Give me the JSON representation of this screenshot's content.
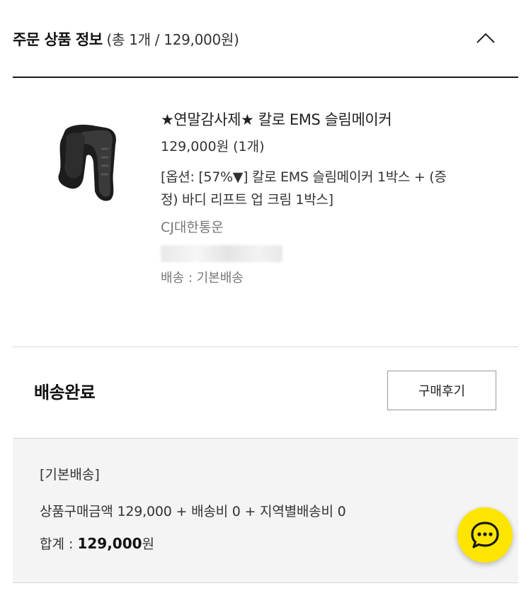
{
  "header": {
    "title": "주문 상품 정보",
    "summary": "(총 1개 / 129,000원)"
  },
  "product": {
    "name": "★연말감사제★ 칼로 EMS 슬림메이커",
    "price": "129,000원 (1개)",
    "option": "[옵션: [57%▼] 칼로 EMS 슬림메이커 1박스 + (증정) 바디 리프트 업 크림 1박스]",
    "courier": "CJ대한통운",
    "shipping": "배송 : 기본배송",
    "image_icon": "handheld-ems-device-image"
  },
  "status": {
    "label": "배송완료",
    "review_button": "구매후기"
  },
  "summary": {
    "label": "[기본배송]",
    "detail": "상품구매금액 129,000 + 배송비 0 + 지역별배송비 0",
    "total_prefix": "합계 : ",
    "total_amount": "129,000",
    "total_suffix": "원"
  },
  "chat": {
    "icon": "chat-bubble-icon",
    "color": "#fde500"
  }
}
